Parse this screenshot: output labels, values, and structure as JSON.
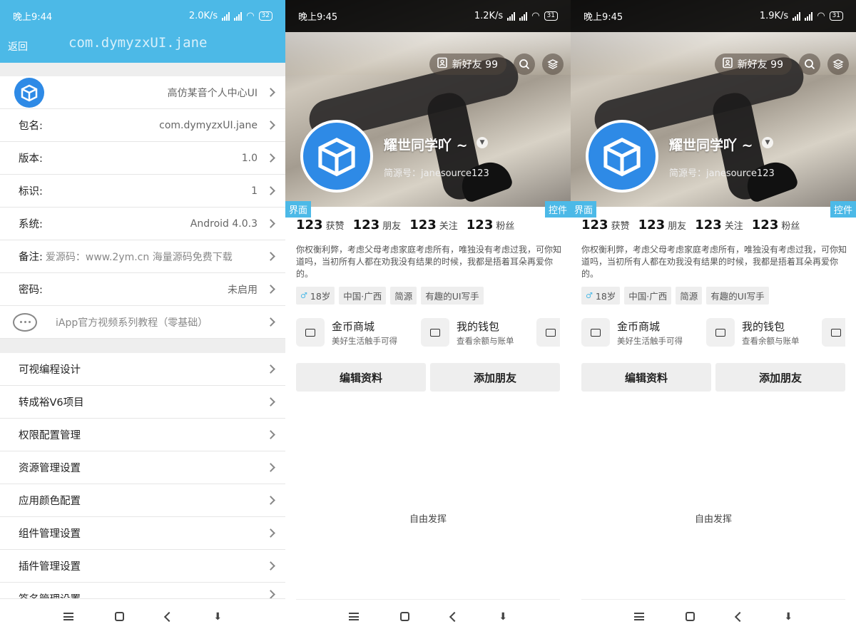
{
  "panel1": {
    "status": {
      "time": "晚上9:44",
      "speed": "2.0K/s",
      "battery": "32"
    },
    "header": {
      "back": "返回",
      "package_title": "com.dymyzxUI.jane"
    },
    "rows": [
      {
        "label": "",
        "value": "高仿某音个人中心UI"
      },
      {
        "label": "包名:",
        "value": "com.dymyzxUI.jane"
      },
      {
        "label": "版本:",
        "value": "1.0"
      },
      {
        "label": "标识:",
        "value": "1"
      },
      {
        "label": "系统:",
        "value": "Android 4.0.3"
      },
      {
        "label": "备注:",
        "value": "爱源码：www.2ym.cn 海量源码免费下载"
      },
      {
        "label": "密码:",
        "value": "未启用"
      },
      {
        "label": "",
        "value": "iApp官方视频系列教程（零基础）"
      }
    ],
    "menu": [
      "可视编程设计",
      "转成裕V6项目",
      "权限配置管理",
      "资源管理设置",
      "应用颜色配置",
      "组件管理设置",
      "插件管理设置",
      "签名管理设置"
    ]
  },
  "profile_panels": [
    {
      "status": {
        "time": "晚上9:45",
        "speed": "1.2K/s",
        "battery": "31"
      }
    },
    {
      "status": {
        "time": "晚上9:45",
        "speed": "1.9K/s",
        "battery": "31"
      }
    }
  ],
  "profile": {
    "new_friends": "新好友 99",
    "name": "耀世同学吖 ~",
    "id_text": "简源号：janesource123",
    "tag_left": "界面",
    "tag_right": "控件",
    "stats": [
      {
        "num": "123",
        "label": "获赞"
      },
      {
        "num": "123",
        "label": "朋友"
      },
      {
        "num": "123",
        "label": "关注"
      },
      {
        "num": "123",
        "label": "粉丝"
      }
    ],
    "bio": "你权衡利弊，考虑父母考虑家庭考虑所有，唯独没有考虑过我，可你知道吗，当初所有人都在劝我没有结果的时候，我都是捂着耳朵再爱你的。",
    "chips": [
      "18岁",
      "中国·广西",
      "简源",
      "有趣的UI写手"
    ],
    "functions": [
      {
        "title": "金币商城",
        "sub": "美好生活触手可得",
        "icon": "basket-icon"
      },
      {
        "title": "我的钱包",
        "sub": "查看余额与账单",
        "icon": "wallet-icon"
      },
      {
        "title": "",
        "sub": "",
        "icon": "folder-icon"
      }
    ],
    "edit_button": "编辑资料",
    "add_friend_button": "添加朋友",
    "free_text": "自由发挥"
  },
  "colors": {
    "accent": "#4cb9e7",
    "app_icon": "#2e8ae6"
  }
}
